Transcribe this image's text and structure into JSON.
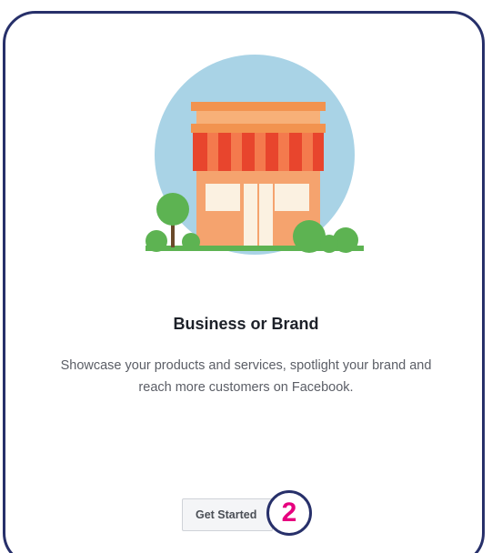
{
  "card": {
    "title": "Business or Brand",
    "description_line1": "Showcase your products and services, spotlight your brand and",
    "description_line2": "reach more customers on Facebook.",
    "button_label": "Get Started",
    "step_number": "2",
    "illustration_icon": "storefront-icon"
  },
  "colors": {
    "frame_border": "#27306a",
    "badge_text": "#e6007e",
    "circle_bg": "#a9d3e6",
    "awning_red": "#e8452d",
    "building_orange": "#f5a36e",
    "roof_orange": "#f2934f",
    "tree_green": "#5db352"
  }
}
